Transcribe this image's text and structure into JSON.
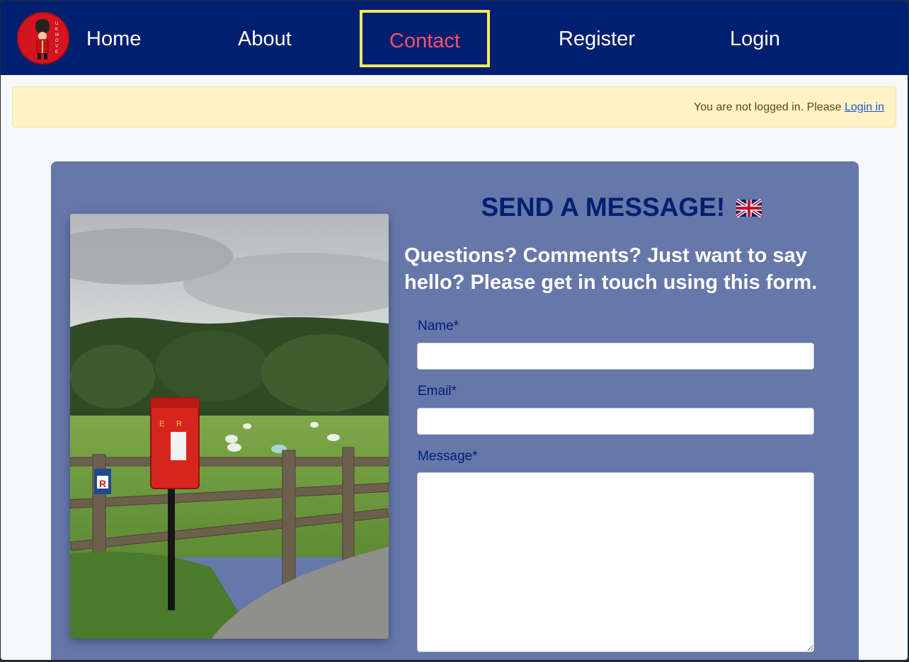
{
  "nav": {
    "home": "Home",
    "about": "About",
    "contact": "Contact",
    "register": "Register",
    "login": "Login",
    "logo_icon": "royal-guard-logo-icon"
  },
  "alert": {
    "text": "You are not logged in. Please ",
    "link": "Login in"
  },
  "contact": {
    "title": "SEND A MESSAGE!",
    "flag_icon": "uk-flag-icon",
    "subtitle": "Questions? Comments? Just want to say hello? Please get in touch using this form.",
    "name_label": "Name*",
    "email_label": "Email*",
    "message_label": "Message*",
    "name_value": "",
    "email_value": "",
    "message_value": ""
  },
  "colors": {
    "nav_bg": "#001f71",
    "active_link": "#f4516c",
    "active_border": "#f9ea5a",
    "card_bg": "#6677aa",
    "alert_bg": "#fff3c6"
  }
}
